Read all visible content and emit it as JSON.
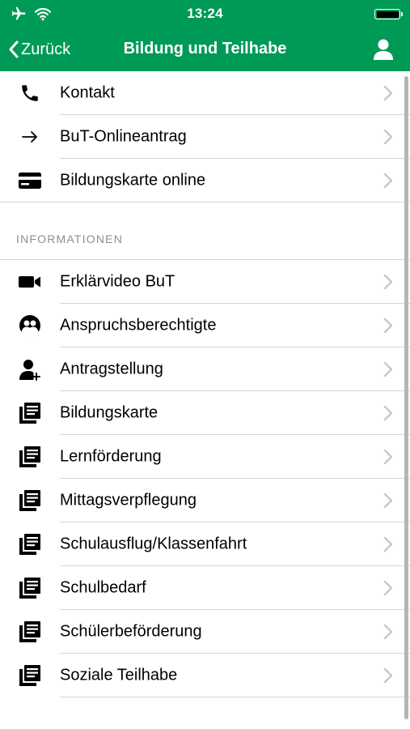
{
  "statusbar": {
    "time": "13:24",
    "icons": [
      "airplane-icon",
      "wifi-icon",
      "battery-icon"
    ]
  },
  "navbar": {
    "back_label": "Zurück",
    "title": "Bildung und Teilhabe",
    "profile_icon": "person-icon"
  },
  "colors": {
    "header_green": "#009a57",
    "separator": "#d6d6d6",
    "section_header_text": "#8e8e93",
    "chevron": "#c7c7cc"
  },
  "top_items": [
    {
      "label": "Kontakt",
      "icon": "phone-icon"
    },
    {
      "label": "BuT-Onlineantrag",
      "icon": "arrow-right-icon"
    },
    {
      "label": "Bildungskarte online",
      "icon": "card-icon"
    }
  ],
  "section": {
    "header": "INFORMATIONEN",
    "items": [
      {
        "label": "Erklärvideo BuT",
        "icon": "video-camera-icon"
      },
      {
        "label": "Anspruchsberechtigte",
        "icon": "group-icon"
      },
      {
        "label": "Antragstellung",
        "icon": "person-add-icon"
      },
      {
        "label": "Bildungskarte",
        "icon": "document-icon"
      },
      {
        "label": "Lernförderung",
        "icon": "document-icon"
      },
      {
        "label": "Mittagsverpflegung",
        "icon": "document-icon"
      },
      {
        "label": "Schulausflug/Klassenfahrt",
        "icon": "document-icon"
      },
      {
        "label": "Schulbedarf",
        "icon": "document-icon"
      },
      {
        "label": "Schülerbeförderung",
        "icon": "document-icon"
      },
      {
        "label": "Soziale Teilhabe",
        "icon": "document-icon"
      }
    ]
  }
}
